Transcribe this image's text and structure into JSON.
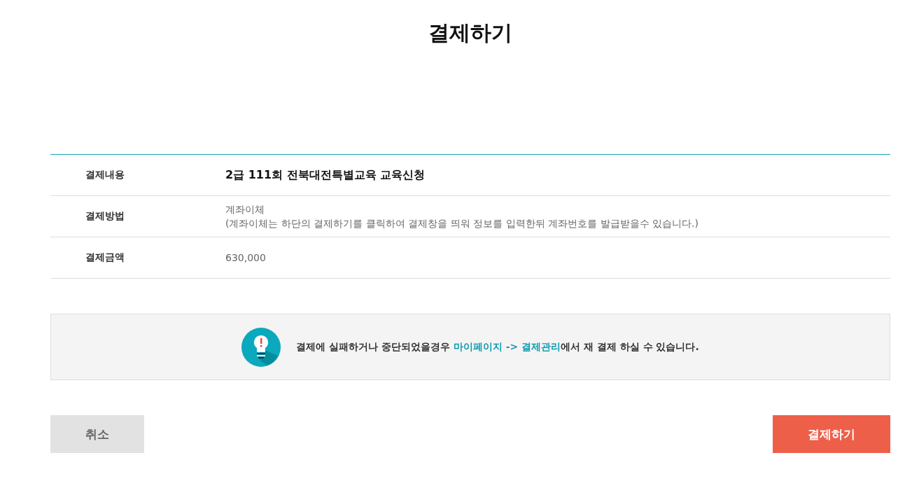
{
  "title": "결제하기",
  "rows": [
    {
      "label": "결제내용",
      "emphasized": true,
      "lines": [
        "2급 111회 전북대전특별교육 교육신청"
      ]
    },
    {
      "label": "결제방법",
      "emphasized": false,
      "lines": [
        "계좌이체",
        "(계좌이체는 하단의 결제하기를 클릭하여 결제창을 띄워 정보를 입력한뒤 계좌번호를 발급받을수 있습니다.)"
      ]
    },
    {
      "label": "결제금액",
      "emphasized": false,
      "lines": [
        "630,000"
      ]
    }
  ],
  "notice": {
    "before": "결제에 실패하거나 중단되었을경우 ",
    "link": "마이페이지 -> 결제관리",
    "after": "에서 재 결제 하실 수 있습니다."
  },
  "buttons": {
    "cancel": "취소",
    "pay": "결제하기"
  }
}
